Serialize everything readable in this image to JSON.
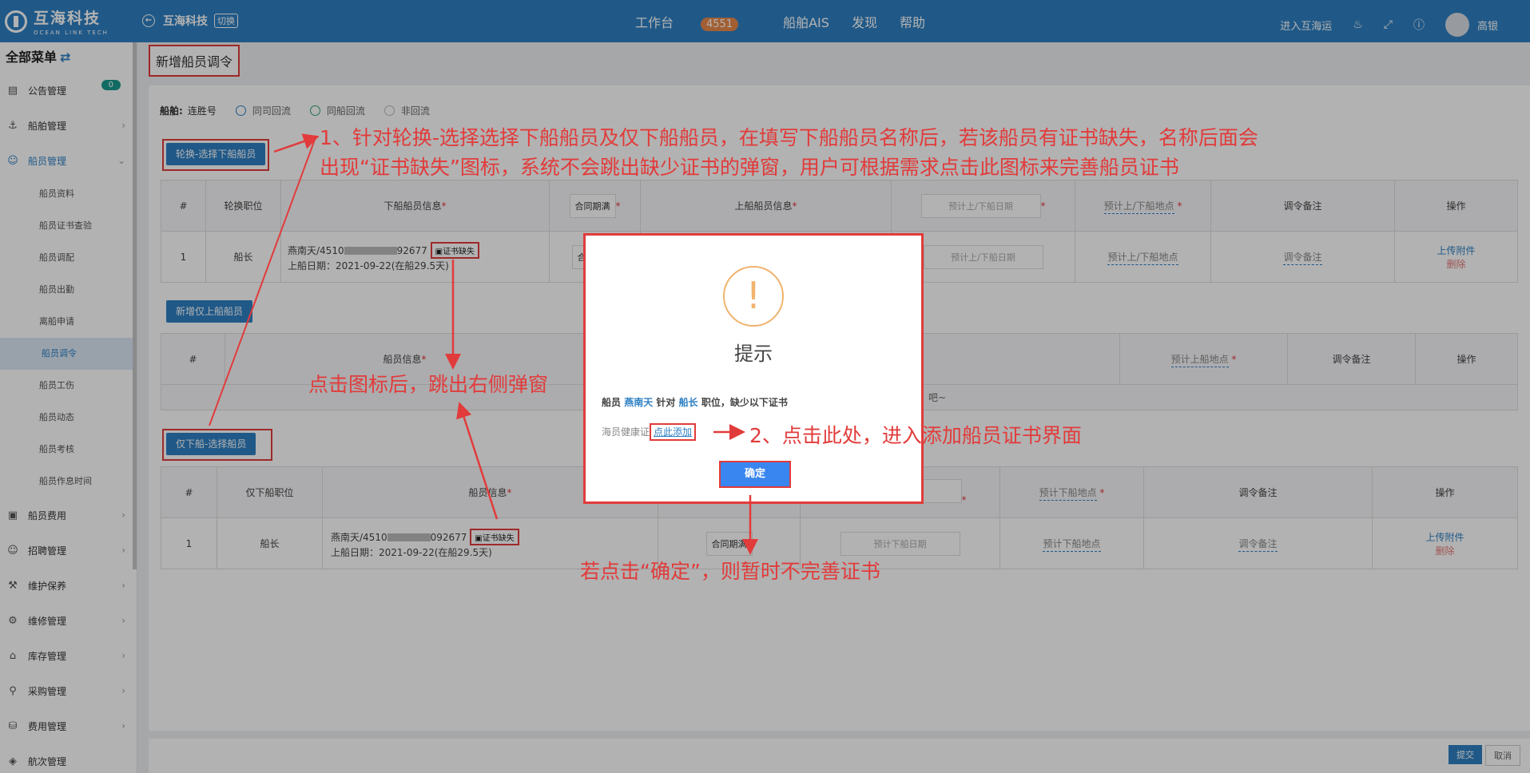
{
  "topbar": {
    "logo_cn": "互海科技",
    "logo_en": "OCEAN LINK TECH",
    "company": "互海科技",
    "switch_label": "切换",
    "nav": {
      "workbench": "工作台",
      "workbench_count": "4551",
      "ais": "船舶AIS",
      "discover": "发现",
      "help": "帮助"
    },
    "enter_label": "进入互海运",
    "user": "高银"
  },
  "sidebar": {
    "title": "全部菜单",
    "items": [
      {
        "label": "公告管理",
        "icon": "notice-icon",
        "badge": "0"
      },
      {
        "label": "船舶管理",
        "icon": "anchor-icon"
      },
      {
        "label": "船员管理",
        "icon": "person-icon"
      }
    ],
    "sub_items": [
      "船员资料",
      "船员证书查验",
      "船员调配",
      "船员出勤",
      "离船申请",
      "船员调令",
      "船员工伤",
      "船员动态",
      "船员考核",
      "船员作息时间"
    ],
    "more_items": [
      {
        "label": "船员费用",
        "icon": "wallet-icon"
      },
      {
        "label": "招聘管理",
        "icon": "recruit-icon"
      },
      {
        "label": "维护保养",
        "icon": "wrench-icon"
      },
      {
        "label": "维修管理",
        "icon": "tool-icon"
      },
      {
        "label": "库存管理",
        "icon": "home-icon"
      },
      {
        "label": "采购管理",
        "icon": "cart-icon"
      },
      {
        "label": "费用管理",
        "icon": "coins-icon"
      },
      {
        "label": "航次管理",
        "icon": "globe-icon"
      }
    ]
  },
  "page": {
    "title": "新增船员调令",
    "ship_label": "船舶:",
    "ship_name": "连胜号",
    "options": [
      "同司回流",
      "同船回流",
      "非回流"
    ],
    "btn_rotation": "轮换-选择下船船员",
    "btn_add_board": "新增仅上船船员",
    "btn_only_off": "仅下船-选择船员",
    "rotation_table": {
      "headers": [
        "#",
        "轮换职位",
        "下船船员信息",
        "合同期满",
        "上船船员信息",
        "预计上/下船日期",
        "预计上/下船地点",
        "调令备注",
        "操作"
      ],
      "row": {
        "no": "1",
        "position": "船长",
        "crew": "燕南天/4510",
        "crew_tail": "92677",
        "cert": "证书缺失",
        "board_date": "上船日期：2021-09-22(在船29.5天)",
        "select": "合同期满",
        "date_ph": "预计上/下船日期",
        "place_ph": "预计上/下船地点",
        "remark_ph": "调令备注",
        "upload": "上传附件",
        "delete": "删除"
      }
    },
    "board_table": {
      "headers": [
        "#",
        "船员信息",
        "预计上船地点",
        "调令备注",
        "操作"
      ],
      "empty_tail": "吧~"
    },
    "off_table": {
      "headers": [
        "#",
        "仅下船职位",
        "船员信息",
        "预计下船地点",
        "调令备注",
        "操作"
      ],
      "row": {
        "no": "1",
        "position": "船长",
        "crew": "燕南天/4510",
        "crew_tail": "092677",
        "cert": "证书缺失",
        "board_date": "上船日期：2021-09-22(在船29.5天)",
        "select": "合同期满",
        "date_ph": "预计下船日期",
        "place_ph": "预计下船地点",
        "remark_ph": "调令备注",
        "upload": "上传附件",
        "delete": "删除"
      }
    },
    "submit": "提交",
    "cancel": "取消"
  },
  "modal": {
    "icon": "!",
    "title": "提示",
    "msg_pre": "船员",
    "crew_name": "燕南天",
    "msg_mid": "针对",
    "position": "船长",
    "msg_post": "职位，缺少以下证书",
    "cert_name": "海员健康证",
    "add_link": "点此添加",
    "ok": "确定"
  },
  "annotations": {
    "a1_line1": "1、针对轮换-选择选择下船船员及仅下船船员，在填写下船船员名称后，若该船员有证书缺失，名称后面会",
    "a1_line2": "出现“证书缺失”图标，系统不会跳出缺少证书的弹窗，用户可根据需求点击此图标来完善船员证书",
    "a2": "点击图标后，跳出右侧弹窗",
    "a3": "2、点击此处，进入添加船员证书界面",
    "a4": "若点击“确定”，则暂时不完善证书"
  }
}
